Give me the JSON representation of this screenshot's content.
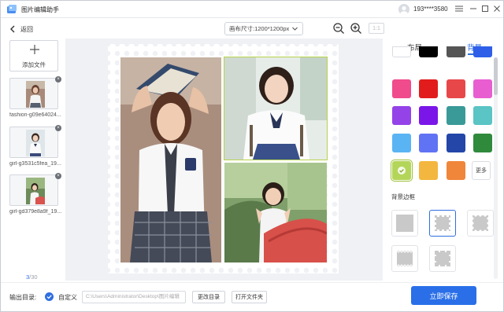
{
  "titlebar": {
    "app_title": "图片编辑助手",
    "user_name": "193****3580",
    "menu_icon": "hamburger-icon",
    "minimize_icon": "minimize-icon",
    "maximize_icon": "maximize-icon",
    "close_icon": "close-icon"
  },
  "toolbar": {
    "back_label": "返回",
    "canvas_size": "画布尺寸:1200*1200px",
    "ratio_label": "1:1"
  },
  "left_panel": {
    "add_file_label": "添加文件",
    "files": [
      {
        "name": "fashion-g09e64024..."
      },
      {
        "name": "girl-g3531c5fea_19..."
      },
      {
        "name": "girl-gd379e8a9f_19..."
      }
    ],
    "page_current": "3",
    "page_total": "/30"
  },
  "right_panel": {
    "tabs": [
      "布局",
      "背景"
    ],
    "active_tab": "背景",
    "colors": [
      "#ffffff",
      "#000000",
      "#555555",
      "#2f5fe8",
      "#f04b8c",
      "#e21c1c",
      "#e8474a",
      "#e85ed0",
      "#9343e8",
      "#7a17e8",
      "#3a9a98",
      "#5bc4c4",
      "#5ab4f4",
      "#6073f4",
      "#2346a8",
      "#2f8a3c",
      "#b3d65a",
      "#f3b63f",
      "#f0863a"
    ],
    "selected_color": "#b3d65a",
    "more_label": "更多",
    "border_section_title": "背景边框"
  },
  "footer": {
    "output_label": "输出目录:",
    "custom_label": "自定义",
    "output_path": "C:\\Users\\Administrator\\Desktop\\图片编辑",
    "change_dir_label": "更改目录",
    "open_folder_label": "打开文件夹",
    "save_label": "立即保存"
  }
}
